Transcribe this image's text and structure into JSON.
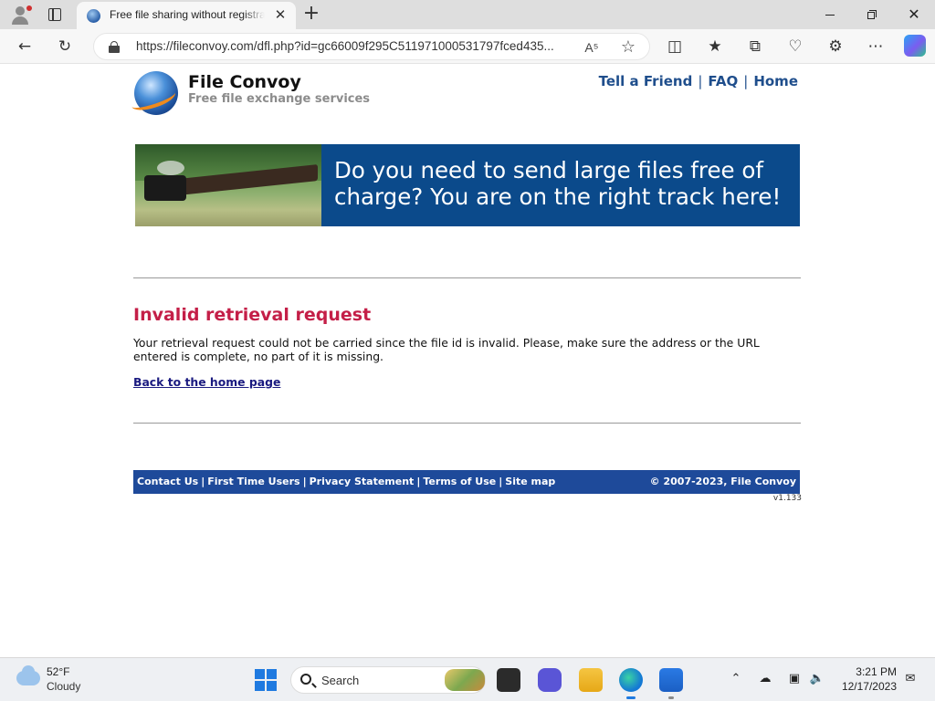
{
  "browser": {
    "tab_title": "Free file sharing without registration",
    "tab_close": "✕",
    "new_tab": "+",
    "url": "https://fileconvoy.com/dfl.php?id=gc66009f295C511971000531797fced435...",
    "read_aloud": "A⁵",
    "window_close": "✕"
  },
  "site": {
    "name": "File Convoy",
    "tagline": "Free file exchange services",
    "nav": [
      {
        "label": "Tell a Friend"
      },
      {
        "label": "FAQ"
      },
      {
        "label": "Home"
      }
    ],
    "nav_separator": "|",
    "banner_text": "Do you  need to send large files free of charge? You are on the right track here!"
  },
  "error": {
    "title": "Invalid retrieval request",
    "message": "Your retrieval request could not be carried since the file id is invalid. Please, make sure the address or the URL entered is complete, no part of it is missing.",
    "back_link": "Back to the home page"
  },
  "footer": {
    "links": [
      {
        "label": "Contact Us"
      },
      {
        "label": "First Time Users"
      },
      {
        "label": "Privacy Statement"
      },
      {
        "label": "Terms of Use"
      },
      {
        "label": "Site map"
      }
    ],
    "separator": "|",
    "copyright": "© 2007-2023, File Convoy",
    "version": "v1.133"
  },
  "taskbar": {
    "weather_temp": "52°F",
    "weather_desc": "Cloudy",
    "search_label": "Search",
    "time": "3:21 PM",
    "date": "12/17/2023"
  },
  "colors": {
    "brand_blue": "#1e4a9a",
    "error_red": "#c41f48",
    "banner_blue": "#0b4a8b"
  }
}
